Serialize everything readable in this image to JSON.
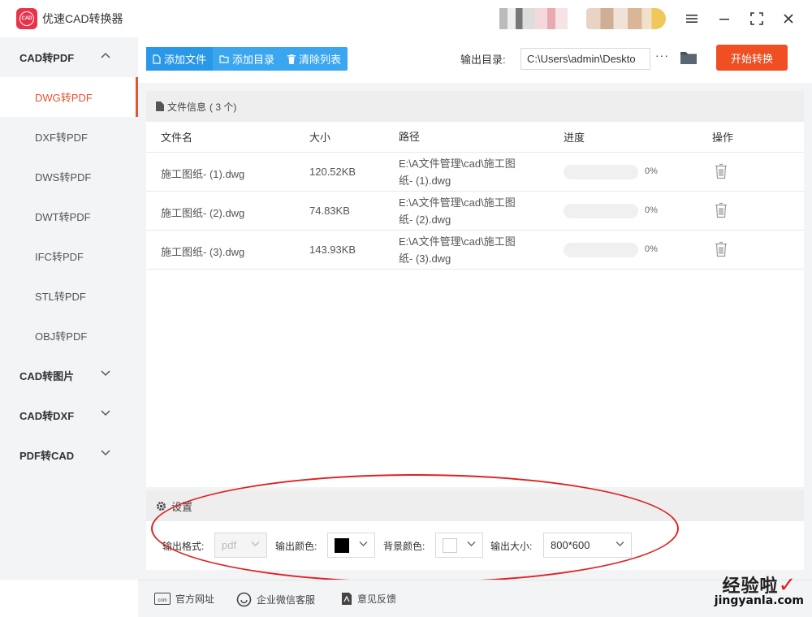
{
  "app": {
    "title": "优速CAD转换器",
    "logo_text": "CAD"
  },
  "sidebar": {
    "groups": [
      {
        "label": "CAD转PDF",
        "expanded": true,
        "items": [
          "DWG转PDF",
          "DXF转PDF",
          "DWS转PDF",
          "DWT转PDF",
          "IFC转PDF",
          "STL转PDF",
          "OBJ转PDF"
        ]
      },
      {
        "label": "CAD转图片",
        "expanded": false
      },
      {
        "label": "CAD转DXF",
        "expanded": false
      },
      {
        "label": "PDF转CAD",
        "expanded": false
      }
    ],
    "active_item": "DWG转PDF"
  },
  "toolbar": {
    "add_file": "添加文件",
    "add_dir": "添加目录",
    "clear_list": "清除列表",
    "output_label": "输出目录:",
    "output_path": "C:\\Users\\admin\\Deskto",
    "more": "···",
    "start": "开始转换"
  },
  "file_panel": {
    "title": "文件信息",
    "count": "( 3 个)",
    "columns": [
      "文件名",
      "大小",
      "路径",
      "进度",
      "操作"
    ],
    "rows": [
      {
        "name": "施工图纸- (1).dwg",
        "size": "120.52KB",
        "path1": "E:\\A文件管理\\cad\\施工图",
        "path2": "纸- (1).dwg",
        "progress": "0%",
        "progress_value": 0
      },
      {
        "name": "施工图纸- (2).dwg",
        "size": "74.83KB",
        "path1": "E:\\A文件管理\\cad\\施工图",
        "path2": "纸- (2).dwg",
        "progress": "0%",
        "progress_value": 0
      },
      {
        "name": "施工图纸- (3).dwg",
        "size": "143.93KB",
        "path1": "E:\\A文件管理\\cad\\施工图",
        "path2": "纸- (3).dwg",
        "progress": "0%",
        "progress_value": 0
      }
    ]
  },
  "settings": {
    "title": "设置",
    "format_label": "输出格式:",
    "format_value": "pdf",
    "color_label": "输出颜色:",
    "color_value": "#000000",
    "bg_label": "背景颜色:",
    "bg_value": "#ffffff",
    "size_label": "输出大小:",
    "size_value": "800*600"
  },
  "footer": {
    "website": "官方网址",
    "wechat": "企业微信客服",
    "feedback": "意见反馈",
    "website_icon_text": "com"
  },
  "watermark": {
    "cn": "经验啦",
    "url": "jingyanla.com"
  },
  "colors": {
    "accent": "#f04e23",
    "active": "#e8522f",
    "toolbar_blue": "#3aa6f0",
    "annotation": "#e02020"
  }
}
